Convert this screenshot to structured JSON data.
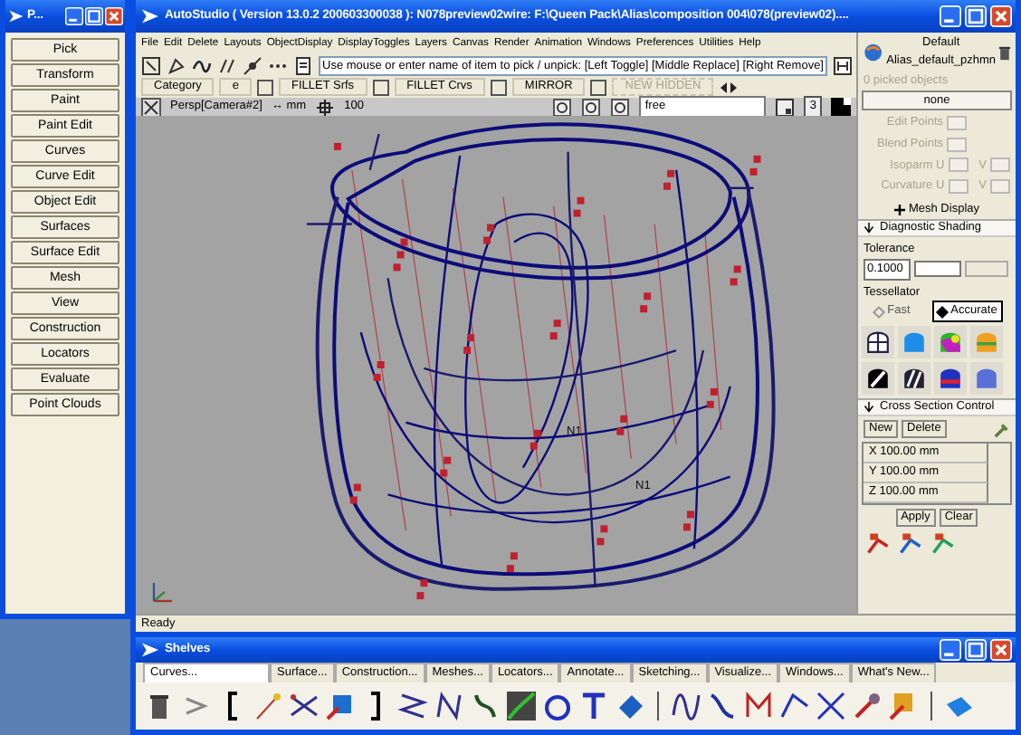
{
  "palette": {
    "title": "P...",
    "buttons": [
      "Pick",
      "Transform",
      "Paint",
      "Paint Edit",
      "Curves",
      "Curve Edit",
      "Object Edit",
      "Surfaces",
      "Surface Edit",
      "Mesh",
      "View",
      "Construction",
      "Locators",
      "Evaluate",
      "Point Clouds"
    ]
  },
  "main": {
    "title": "AutoStudio ( Version 13.0.2  200603300038 ): N078preview02wire: F:\\Queen Pack\\Alias\\composition 004\\078(preview02)....",
    "menu": [
      "File",
      "Edit",
      "Delete",
      "Layouts",
      "ObjectDisplay",
      "DisplayToggles",
      "Layers",
      "Canvas",
      "Render",
      "Animation",
      "Windows",
      "Preferences",
      "Utilities",
      "Help"
    ],
    "prompt": "Use mouse or enter name of item to pick / unpick: [Left Toggle] [Middle Replace] [Right Remove]",
    "category": "Category",
    "strip": [
      {
        "kind": "label",
        "text": "e",
        "disabled": false
      },
      {
        "kind": "check",
        "checked": false
      },
      {
        "kind": "label",
        "text": "FILLET Srfs",
        "disabled": false
      },
      {
        "kind": "check",
        "checked": false
      },
      {
        "kind": "label",
        "text": "FILLET Crvs",
        "disabled": false
      },
      {
        "kind": "check",
        "checked": false
      },
      {
        "kind": "label",
        "text": "MIRROR",
        "disabled": false
      },
      {
        "kind": "check",
        "checked": false
      },
      {
        "kind": "label",
        "text": "NEW HIDDEN",
        "disabled": true
      }
    ],
    "viewport": {
      "camera": "Persp[Camera#2]",
      "units": "↔ mm",
      "grid": "100",
      "mode": "free",
      "count": "3",
      "labels": [
        "N1",
        "N1"
      ]
    },
    "status": "Ready"
  },
  "control_panel": {
    "shader": "Default",
    "shader_name": "Alias_default_pzhmn",
    "picked": "0 picked objects",
    "pick_value": "none",
    "fields": [
      {
        "label": "Edit Points",
        "disabled": true
      },
      {
        "label": "Blend Points",
        "disabled": true
      },
      {
        "label": "Isoparm U",
        "v_label": "V",
        "disabled": true
      },
      {
        "label": "Curvature U",
        "v_label": "V",
        "disabled": true
      }
    ],
    "mesh_display": "Mesh Display",
    "diagnostic": {
      "title": "Diagnostic Shading",
      "tolerance_label": "Tolerance",
      "tolerance": "0.1000",
      "tessellator_label": "Tessellator",
      "options": [
        {
          "label": "Fast",
          "selected": false
        },
        {
          "label": "Accurate",
          "selected": true
        }
      ]
    },
    "cross_section": {
      "title": "Cross Section Control",
      "new": "New",
      "delete": "Delete",
      "rows": [
        "X 100.00 mm",
        "Y 100.00 mm",
        "Z 100.00 mm"
      ],
      "apply": "Apply",
      "clear": "Clear"
    }
  },
  "shelves": {
    "title": "Shelves",
    "tabs": [
      {
        "label": "Curves...",
        "selected": true
      },
      {
        "label": "Surface...",
        "selected": false
      },
      {
        "label": "Construction...",
        "selected": false
      },
      {
        "label": "Meshes...",
        "selected": false
      },
      {
        "label": "Locators...",
        "selected": false
      },
      {
        "label": "Annotate...",
        "selected": false
      },
      {
        "label": "Sketching...",
        "selected": false
      },
      {
        "label": "Visualize...",
        "selected": false
      },
      {
        "label": "Windows...",
        "selected": false
      },
      {
        "label": "What's New...",
        "selected": false
      }
    ]
  }
}
